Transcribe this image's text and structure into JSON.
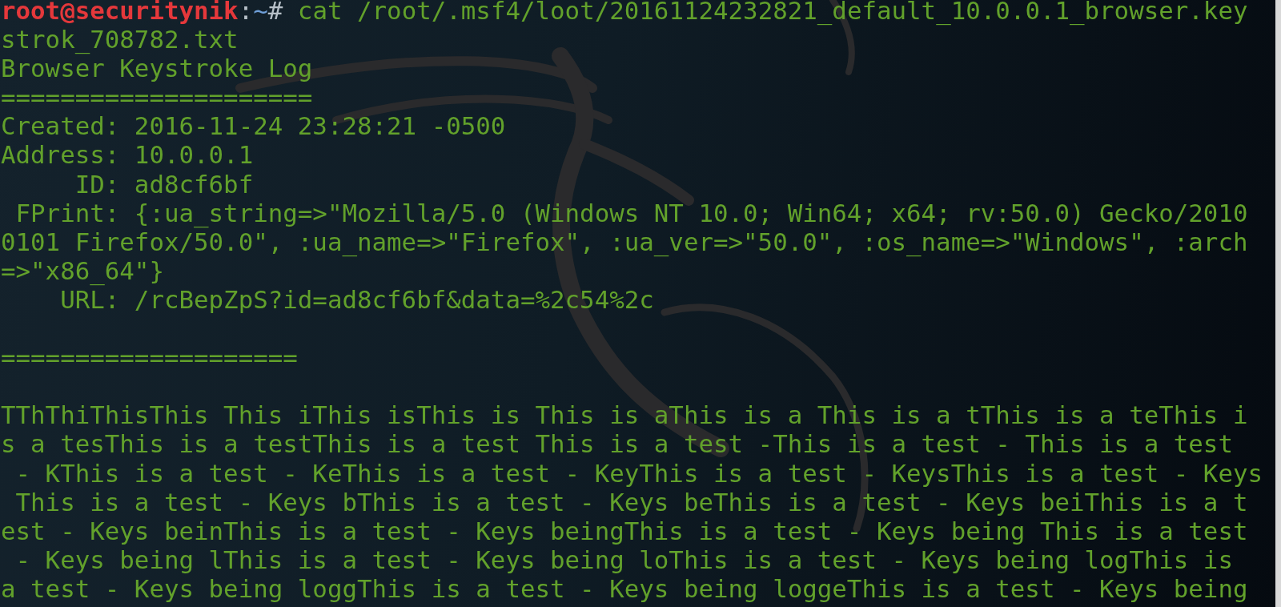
{
  "terminal": {
    "lines": [
      {
        "kind": "prompt",
        "user": "root@securitynik",
        "separator": ":",
        "path": "~",
        "symbol": "#",
        "command": " cat /root/.msf4/loot/20161124232821_default_10.0.0.1_browser.key"
      },
      {
        "kind": "output",
        "text": "strok_708782.txt"
      },
      {
        "kind": "output",
        "text": "Browser Keystroke Log"
      },
      {
        "kind": "output",
        "text": "====================="
      },
      {
        "kind": "output",
        "text": "Created: 2016-11-24 23:28:21 -0500"
      },
      {
        "kind": "output",
        "text": "Address: 10.0.0.1"
      },
      {
        "kind": "output",
        "text": "     ID: ad8cf6bf"
      },
      {
        "kind": "output",
        "text": " FPrint: {:ua_string=>\"Mozilla/5.0 (Windows NT 10.0; Win64; x64; rv:50.0) Gecko/2010"
      },
      {
        "kind": "output",
        "text": "0101 Firefox/50.0\", :ua_name=>\"Firefox\", :ua_ver=>\"50.0\", :os_name=>\"Windows\", :arch"
      },
      {
        "kind": "output",
        "text": "=>\"x86_64\"}"
      },
      {
        "kind": "output",
        "text": "    URL: /rcBepZpS?id=ad8cf6bf&data=%2c54%2c"
      },
      {
        "kind": "blank"
      },
      {
        "kind": "output",
        "text": "===================="
      },
      {
        "kind": "blank"
      },
      {
        "kind": "output",
        "text": "TThThiThisThis This iThis isThis is This is aThis is a This is a tThis is a teThis i"
      },
      {
        "kind": "output",
        "text": "s a tesThis is a testThis is a test This is a test -This is a test - This is a test"
      },
      {
        "kind": "output",
        "text": " - KThis is a test - KeThis is a test - KeyThis is a test - KeysThis is a test - Keys"
      },
      {
        "kind": "output",
        "text": " This is a test - Keys bThis is a test - Keys beThis is a test - Keys beiThis is a t"
      },
      {
        "kind": "output",
        "text": "est - Keys beinThis is a test - Keys beingThis is a test - Keys being This is a test"
      },
      {
        "kind": "output",
        "text": " - Keys being lThis is a test - Keys being loThis is a test - Keys being logThis is"
      },
      {
        "kind": "output",
        "text": "a test - Keys being loggThis is a test - Keys being loggeThis is a test - Keys being"
      }
    ]
  }
}
